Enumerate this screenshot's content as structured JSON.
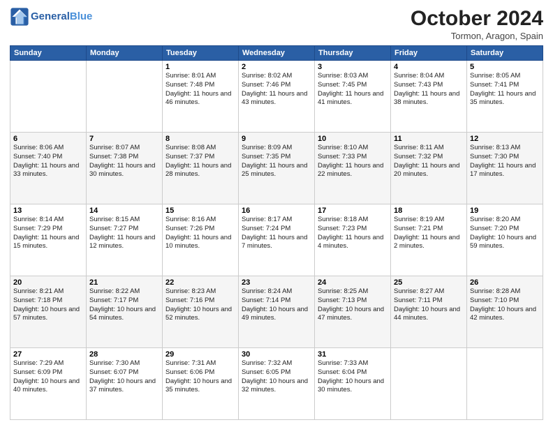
{
  "header": {
    "logo_general": "General",
    "logo_blue": "Blue",
    "month_title": "October 2024",
    "subtitle": "Tormon, Aragon, Spain"
  },
  "weekdays": [
    "Sunday",
    "Monday",
    "Tuesday",
    "Wednesday",
    "Thursday",
    "Friday",
    "Saturday"
  ],
  "weeks": [
    [
      {
        "day": "",
        "info": ""
      },
      {
        "day": "",
        "info": ""
      },
      {
        "day": "1",
        "info": "Sunrise: 8:01 AM\nSunset: 7:48 PM\nDaylight: 11 hours and 46 minutes."
      },
      {
        "day": "2",
        "info": "Sunrise: 8:02 AM\nSunset: 7:46 PM\nDaylight: 11 hours and 43 minutes."
      },
      {
        "day": "3",
        "info": "Sunrise: 8:03 AM\nSunset: 7:45 PM\nDaylight: 11 hours and 41 minutes."
      },
      {
        "day": "4",
        "info": "Sunrise: 8:04 AM\nSunset: 7:43 PM\nDaylight: 11 hours and 38 minutes."
      },
      {
        "day": "5",
        "info": "Sunrise: 8:05 AM\nSunset: 7:41 PM\nDaylight: 11 hours and 35 minutes."
      }
    ],
    [
      {
        "day": "6",
        "info": "Sunrise: 8:06 AM\nSunset: 7:40 PM\nDaylight: 11 hours and 33 minutes."
      },
      {
        "day": "7",
        "info": "Sunrise: 8:07 AM\nSunset: 7:38 PM\nDaylight: 11 hours and 30 minutes."
      },
      {
        "day": "8",
        "info": "Sunrise: 8:08 AM\nSunset: 7:37 PM\nDaylight: 11 hours and 28 minutes."
      },
      {
        "day": "9",
        "info": "Sunrise: 8:09 AM\nSunset: 7:35 PM\nDaylight: 11 hours and 25 minutes."
      },
      {
        "day": "10",
        "info": "Sunrise: 8:10 AM\nSunset: 7:33 PM\nDaylight: 11 hours and 22 minutes."
      },
      {
        "day": "11",
        "info": "Sunrise: 8:11 AM\nSunset: 7:32 PM\nDaylight: 11 hours and 20 minutes."
      },
      {
        "day": "12",
        "info": "Sunrise: 8:13 AM\nSunset: 7:30 PM\nDaylight: 11 hours and 17 minutes."
      }
    ],
    [
      {
        "day": "13",
        "info": "Sunrise: 8:14 AM\nSunset: 7:29 PM\nDaylight: 11 hours and 15 minutes."
      },
      {
        "day": "14",
        "info": "Sunrise: 8:15 AM\nSunset: 7:27 PM\nDaylight: 11 hours and 12 minutes."
      },
      {
        "day": "15",
        "info": "Sunrise: 8:16 AM\nSunset: 7:26 PM\nDaylight: 11 hours and 10 minutes."
      },
      {
        "day": "16",
        "info": "Sunrise: 8:17 AM\nSunset: 7:24 PM\nDaylight: 11 hours and 7 minutes."
      },
      {
        "day": "17",
        "info": "Sunrise: 8:18 AM\nSunset: 7:23 PM\nDaylight: 11 hours and 4 minutes."
      },
      {
        "day": "18",
        "info": "Sunrise: 8:19 AM\nSunset: 7:21 PM\nDaylight: 11 hours and 2 minutes."
      },
      {
        "day": "19",
        "info": "Sunrise: 8:20 AM\nSunset: 7:20 PM\nDaylight: 10 hours and 59 minutes."
      }
    ],
    [
      {
        "day": "20",
        "info": "Sunrise: 8:21 AM\nSunset: 7:18 PM\nDaylight: 10 hours and 57 minutes."
      },
      {
        "day": "21",
        "info": "Sunrise: 8:22 AM\nSunset: 7:17 PM\nDaylight: 10 hours and 54 minutes."
      },
      {
        "day": "22",
        "info": "Sunrise: 8:23 AM\nSunset: 7:16 PM\nDaylight: 10 hours and 52 minutes."
      },
      {
        "day": "23",
        "info": "Sunrise: 8:24 AM\nSunset: 7:14 PM\nDaylight: 10 hours and 49 minutes."
      },
      {
        "day": "24",
        "info": "Sunrise: 8:25 AM\nSunset: 7:13 PM\nDaylight: 10 hours and 47 minutes."
      },
      {
        "day": "25",
        "info": "Sunrise: 8:27 AM\nSunset: 7:11 PM\nDaylight: 10 hours and 44 minutes."
      },
      {
        "day": "26",
        "info": "Sunrise: 8:28 AM\nSunset: 7:10 PM\nDaylight: 10 hours and 42 minutes."
      }
    ],
    [
      {
        "day": "27",
        "info": "Sunrise: 7:29 AM\nSunset: 6:09 PM\nDaylight: 10 hours and 40 minutes."
      },
      {
        "day": "28",
        "info": "Sunrise: 7:30 AM\nSunset: 6:07 PM\nDaylight: 10 hours and 37 minutes."
      },
      {
        "day": "29",
        "info": "Sunrise: 7:31 AM\nSunset: 6:06 PM\nDaylight: 10 hours and 35 minutes."
      },
      {
        "day": "30",
        "info": "Sunrise: 7:32 AM\nSunset: 6:05 PM\nDaylight: 10 hours and 32 minutes."
      },
      {
        "day": "31",
        "info": "Sunrise: 7:33 AM\nSunset: 6:04 PM\nDaylight: 10 hours and 30 minutes."
      },
      {
        "day": "",
        "info": ""
      },
      {
        "day": "",
        "info": ""
      }
    ]
  ]
}
